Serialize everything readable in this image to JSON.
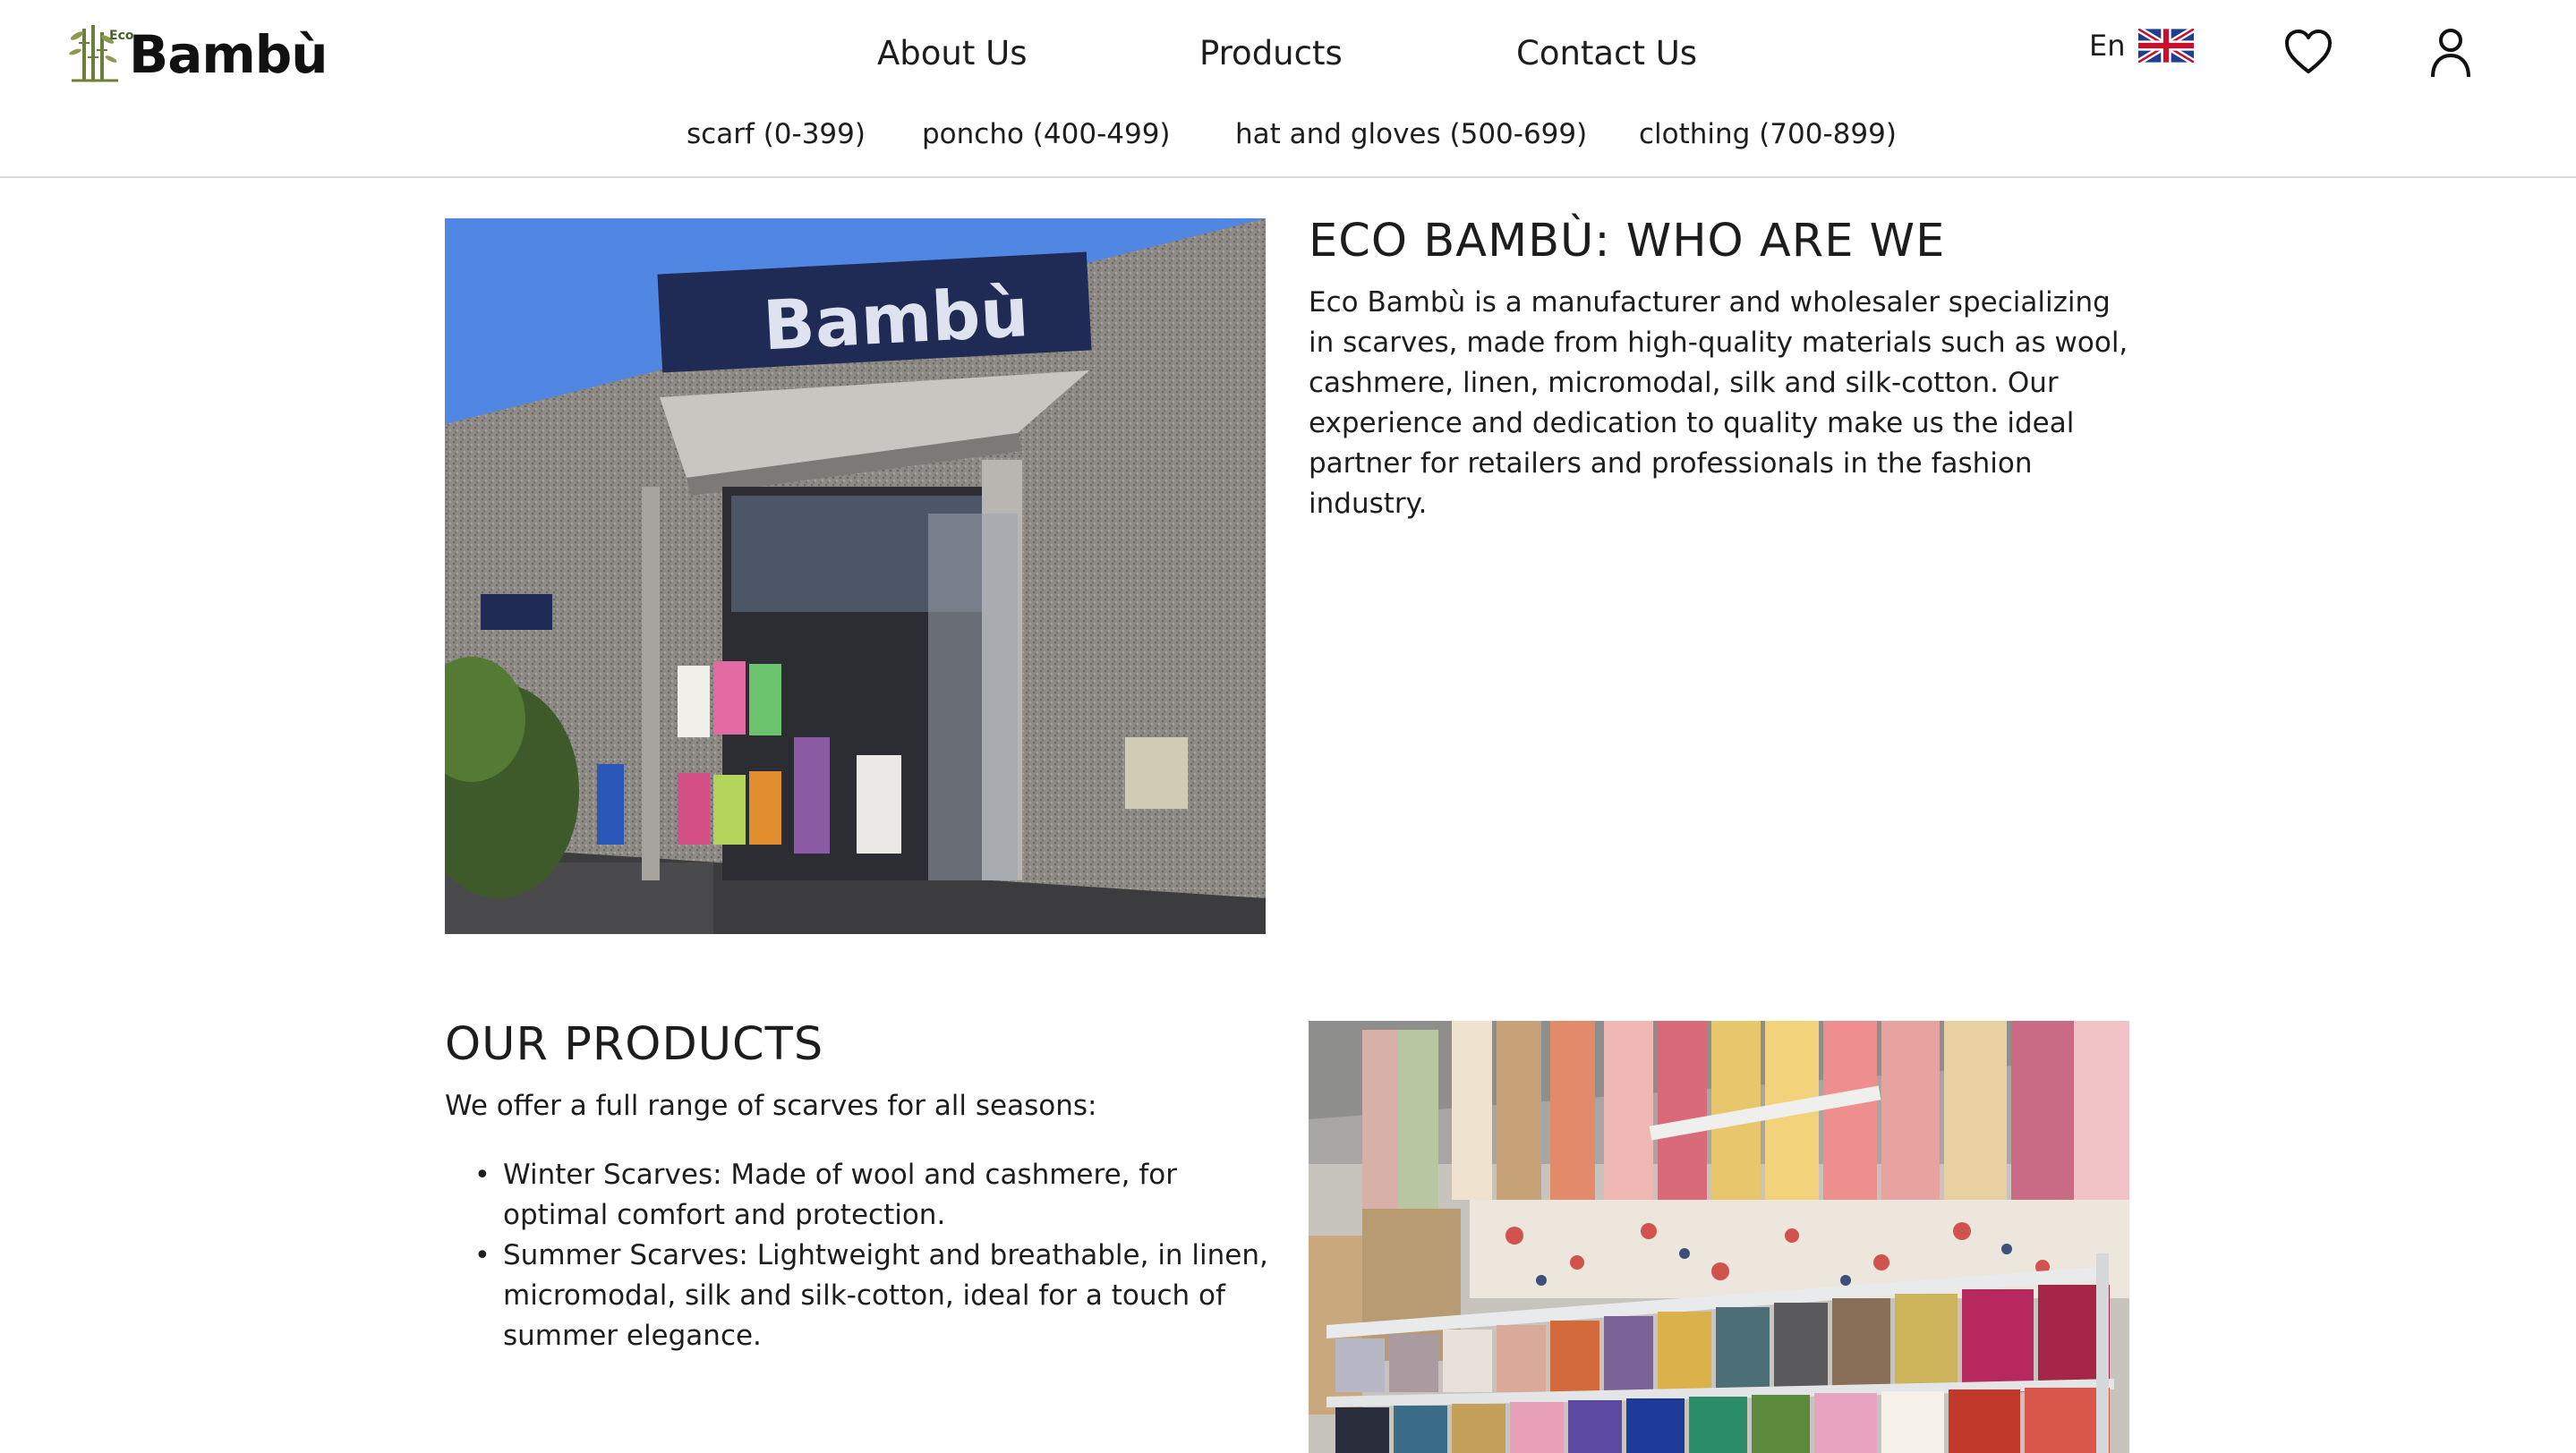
{
  "brand": {
    "eco": "Eco",
    "name": "Bambù"
  },
  "nav": {
    "about": "About Us",
    "products": "Products",
    "contact": "Contact Us"
  },
  "language": {
    "label": "En",
    "flag": "uk-flag-icon"
  },
  "icons": {
    "wishlist": "heart-icon",
    "account": "user-icon"
  },
  "categories": [
    "scarf (0-399)",
    "poncho (400-499)",
    "hat and gloves (500-699)",
    "clothing (700-899)"
  ],
  "about": {
    "title": "ECO BAMBÙ: WHO ARE WE",
    "text": "Eco Bambù is a manufacturer and wholesaler specializing in scarves, made from high-quality materials such as wool, cashmere, linen, micromodal, silk and silk-cotton. Our experience and dedication to quality make us the ideal partner for retailers and professionals in the fashion industry.",
    "store_sign": "Bambù"
  },
  "products": {
    "title": "OUR PRODUCTS",
    "intro": "We offer a full range of scarves for all seasons:",
    "items": [
      "Winter Scarves: Made of wool and cashmere, for optimal comfort and protection.",
      "Summer Scarves: Lightweight and breathable, in linen, micromodal, silk and silk-cotton, ideal for a touch of summer elegance."
    ]
  },
  "colors": {
    "text": "#1d1d1d",
    "border": "#d9d9d9",
    "logo_green": "#6b7f3a",
    "sign_blue": "#1f2a55"
  }
}
